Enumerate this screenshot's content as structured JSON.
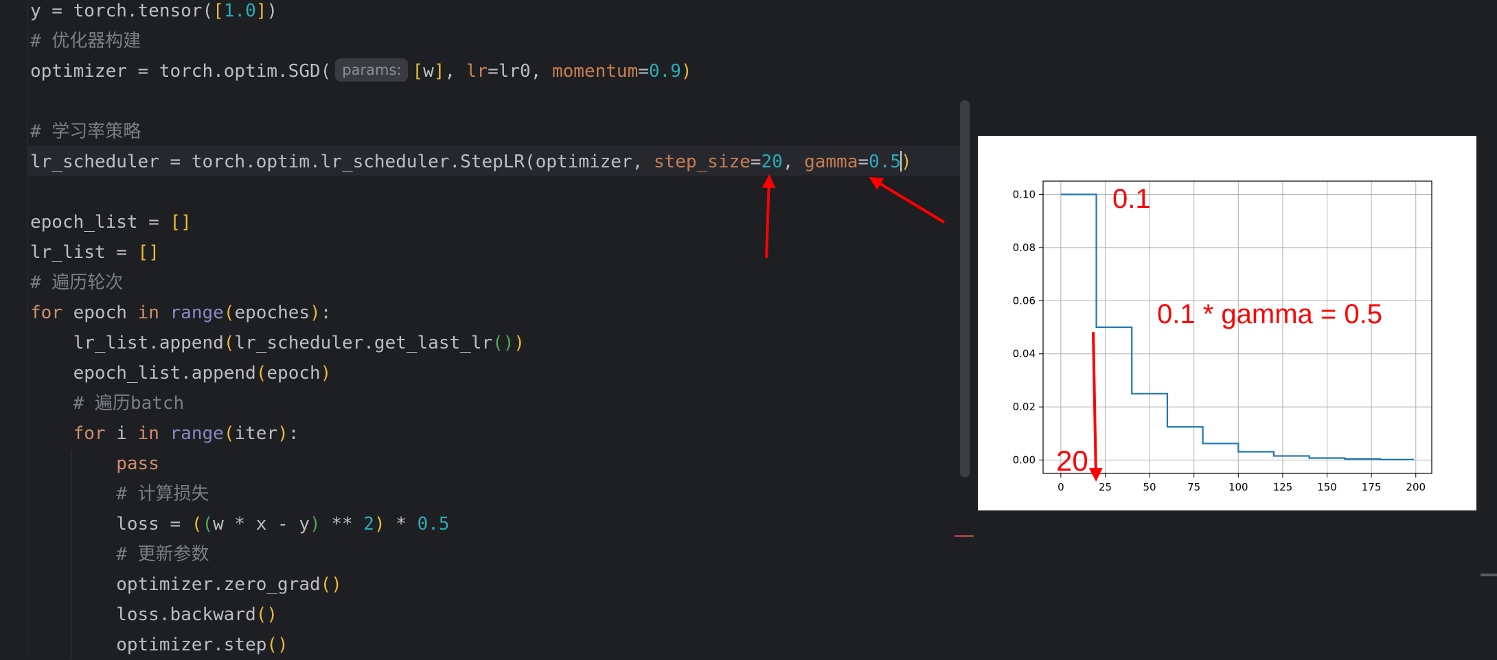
{
  "editor": {
    "lines": [
      {
        "segments": [
          {
            "t": "y = torch.tensor("
          },
          {
            "t": "[",
            "c": "br1"
          },
          {
            "t": "1.0",
            "c": "num"
          },
          {
            "t": "]",
            "c": "br1"
          },
          {
            "t": ")"
          }
        ]
      },
      {
        "segments": [
          {
            "t": "# 优化器构建",
            "c": "cmt"
          }
        ]
      },
      {
        "segments": [
          {
            "t": "optimizer = torch.optim.SGD("
          },
          {
            "t": "params:",
            "c": "hint"
          },
          {
            "t": "[",
            "c": "br1"
          },
          {
            "t": "w"
          },
          {
            "t": "]",
            "c": "br1"
          },
          {
            "t": ", "
          },
          {
            "t": "lr",
            "c": "param"
          },
          {
            "t": "=lr0, "
          },
          {
            "t": "momentum",
            "c": "param"
          },
          {
            "t": "="
          },
          {
            "t": "0.9",
            "c": "num"
          },
          {
            "t": ")",
            "c": "br1"
          }
        ]
      },
      {
        "segments": []
      },
      {
        "segments": [
          {
            "t": "# 学习率策略",
            "c": "cmt"
          }
        ]
      },
      {
        "segments": [
          {
            "t": "lr_scheduler = torch.optim.lr_scheduler.StepLR("
          },
          {
            "t": "optimizer, "
          },
          {
            "t": "step_size",
            "c": "param"
          },
          {
            "t": "="
          },
          {
            "t": "20",
            "c": "num"
          },
          {
            "t": ", "
          },
          {
            "t": "gamma",
            "c": "param"
          },
          {
            "t": "="
          },
          {
            "t": "0.5",
            "c": "num"
          },
          {
            "t": "",
            "c": "caret"
          },
          {
            "t": ")",
            "c": "br1"
          }
        ]
      },
      {
        "segments": []
      },
      {
        "segments": [
          {
            "t": "epoch_list = "
          },
          {
            "t": "[]",
            "c": "br1"
          }
        ]
      },
      {
        "segments": [
          {
            "t": "lr_list = "
          },
          {
            "t": "[]",
            "c": "br1"
          }
        ]
      },
      {
        "segments": [
          {
            "t": "# 遍历轮次",
            "c": "cmt"
          }
        ]
      },
      {
        "segments": [
          {
            "t": "for",
            "c": "kw"
          },
          {
            "t": " epoch "
          },
          {
            "t": "in",
            "c": "kw"
          },
          {
            "t": " "
          },
          {
            "t": "range",
            "c": "bi"
          },
          {
            "t": "(",
            "c": "br1"
          },
          {
            "t": "epoches"
          },
          {
            "t": ")",
            "c": "br1"
          },
          {
            "t": ":"
          }
        ]
      },
      {
        "segments": [
          {
            "t": "    lr_list.append"
          },
          {
            "t": "(",
            "c": "br1"
          },
          {
            "t": "lr_scheduler.get_last_lr"
          },
          {
            "t": "()",
            "c": "br2"
          },
          {
            "t": ")",
            "c": "br1"
          }
        ]
      },
      {
        "segments": [
          {
            "t": "    epoch_list.append"
          },
          {
            "t": "(",
            "c": "br1"
          },
          {
            "t": "epoch"
          },
          {
            "t": ")",
            "c": "br1"
          }
        ]
      },
      {
        "segments": [
          {
            "t": "    # 遍历batch",
            "c": "cmt"
          }
        ]
      },
      {
        "segments": [
          {
            "t": "    "
          },
          {
            "t": "for",
            "c": "kw"
          },
          {
            "t": " i "
          },
          {
            "t": "in",
            "c": "kw"
          },
          {
            "t": " "
          },
          {
            "t": "range",
            "c": "bi"
          },
          {
            "t": "(",
            "c": "br1"
          },
          {
            "t": "iter"
          },
          {
            "t": ")",
            "c": "br1"
          },
          {
            "t": ":"
          }
        ]
      },
      {
        "segments": [
          {
            "t": "        "
          },
          {
            "t": "pass",
            "c": "kw2"
          }
        ]
      },
      {
        "segments": [
          {
            "t": "        # 计算损失",
            "c": "cmt"
          }
        ]
      },
      {
        "segments": [
          {
            "t": "        loss = "
          },
          {
            "t": "(",
            "c": "br1"
          },
          {
            "t": "(",
            "c": "br2"
          },
          {
            "t": "w * x - y"
          },
          {
            "t": ")",
            "c": "br2"
          },
          {
            "t": " ** "
          },
          {
            "t": "2",
            "c": "num"
          },
          {
            "t": ")",
            "c": "br1"
          },
          {
            "t": " * "
          },
          {
            "t": "0.5",
            "c": "num"
          }
        ]
      },
      {
        "segments": [
          {
            "t": "        # 更新参数",
            "c": "cmt"
          }
        ]
      },
      {
        "segments": [
          {
            "t": "        optimizer.zero_grad"
          },
          {
            "t": "()",
            "c": "br1"
          }
        ]
      },
      {
        "segments": [
          {
            "t": "        loss.backward"
          },
          {
            "t": "()",
            "c": "br1"
          }
        ]
      },
      {
        "segments": [
          {
            "t": "        optimizer.step"
          },
          {
            "t": "()",
            "c": "br1"
          }
        ]
      }
    ]
  },
  "colors": {
    "background": "#1e1f22",
    "text": "#bcbec4",
    "comment": "#7a7e85",
    "number": "#2aacb8",
    "keyword": "#cf8e6d",
    "builtin": "#8888c6",
    "param": "#c77d52",
    "bracket1": "#e8ba36",
    "bracket2": "#54a857",
    "annotation": "#ff0000",
    "series": "#1f77b4"
  },
  "annotations": {
    "lr_label": "0.1",
    "gamma_label": "0.1 * gamma = 0.5",
    "step_label": "20"
  },
  "chart_data": {
    "type": "line",
    "x": [
      0,
      20,
      20,
      40,
      40,
      60,
      60,
      80,
      80,
      100,
      100,
      120,
      120,
      140,
      140,
      160,
      160,
      180,
      180,
      199
    ],
    "series": [
      {
        "values": [
          0.1,
          0.1,
          0.05,
          0.05,
          0.025,
          0.025,
          0.0125,
          0.0125,
          0.00625,
          0.00625,
          0.003125,
          0.003125,
          0.0015625,
          0.0015625,
          0.00078125,
          0.00078125,
          0.000390625,
          0.000390625,
          0.0001953125,
          0.0001953125
        ]
      }
    ],
    "xticks": [
      0,
      25,
      50,
      75,
      100,
      125,
      150,
      175,
      200
    ],
    "yticks": [
      0.0,
      0.02,
      0.04,
      0.06,
      0.08,
      0.1
    ],
    "xtick_labels": [
      "0",
      "25",
      "50",
      "75",
      "100",
      "125",
      "150",
      "175",
      "200"
    ],
    "ytick_labels": [
      "0.00",
      "0.02",
      "0.04",
      "0.06",
      "0.08",
      "0.10"
    ],
    "xlim": [
      -10,
      209
    ],
    "ylim": [
      -0.005,
      0.105
    ],
    "grid": true,
    "title": "",
    "xlabel": "",
    "ylabel": ""
  }
}
